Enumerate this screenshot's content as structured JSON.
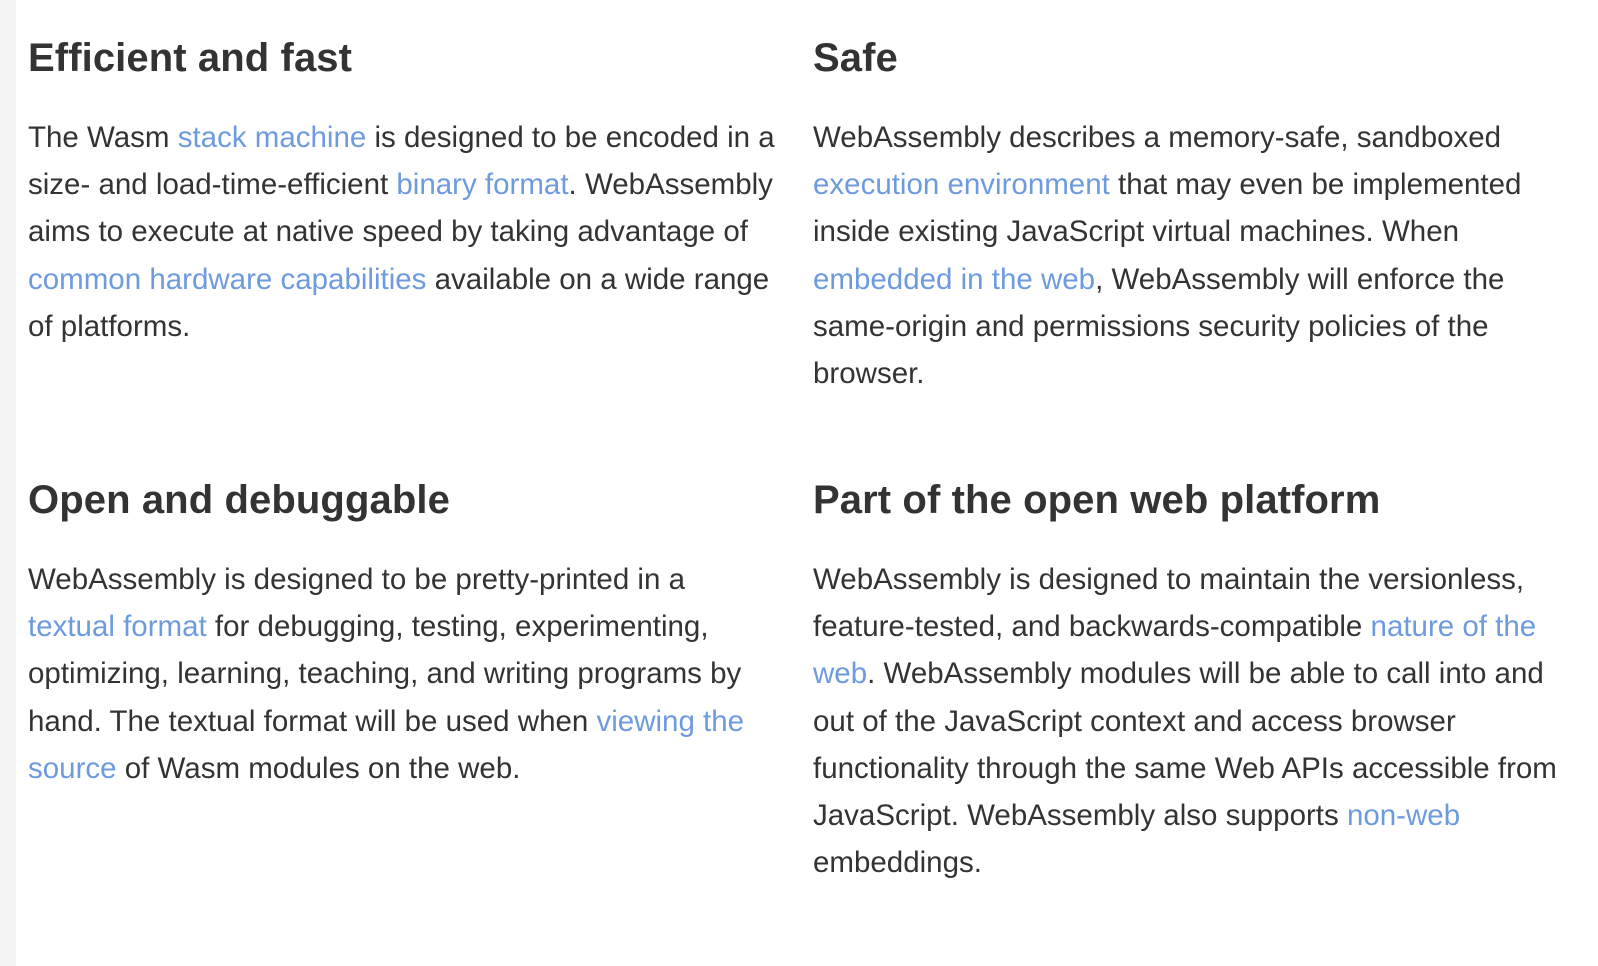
{
  "features": [
    {
      "title": "Efficient and fast",
      "parts": {
        "t0": "The Wasm ",
        "l0": "stack machine",
        "t1": " is designed to be encoded in a size- and load-time-efficient ",
        "l1": "binary format",
        "t2": ". WebAssembly aims to execute at native speed by taking advantage of ",
        "l2": "common hardware capabilities",
        "t3": " available on a wide range of platforms."
      }
    },
    {
      "title": "Safe",
      "parts": {
        "t0": "WebAssembly describes a memory-safe, sandboxed ",
        "l0": "execution environment",
        "t1": " that may even be implemented inside existing JavaScript virtual machines. When ",
        "l1": "embedded in the web",
        "t2": ", WebAssembly will enforce the same-origin and permissions security policies of the browser."
      }
    },
    {
      "title": "Open and debuggable",
      "parts": {
        "t0": "WebAssembly is designed to be pretty-printed in a ",
        "l0": "textual format",
        "t1": " for debugging, testing, experimenting, optimizing, learning, teaching, and writing programs by hand. The textual format will be used when ",
        "l1": "viewing the source",
        "t2": " of Wasm modules on the web."
      }
    },
    {
      "title": "Part of the open web platform",
      "parts": {
        "t0": "WebAssembly is designed to maintain the versionless, feature-tested, and backwards-compatible ",
        "l0": "nature of the web",
        "t1": ". WebAssembly modules will be able to call into and out of the JavaScript context and access browser functionality through the same Web APIs accessible from JavaScript. WebAssembly also supports ",
        "l1": "non-web",
        "t2": " embeddings."
      }
    }
  ],
  "colors": {
    "text": "#333333",
    "link": "#6d9bde",
    "background": "#ffffff"
  }
}
